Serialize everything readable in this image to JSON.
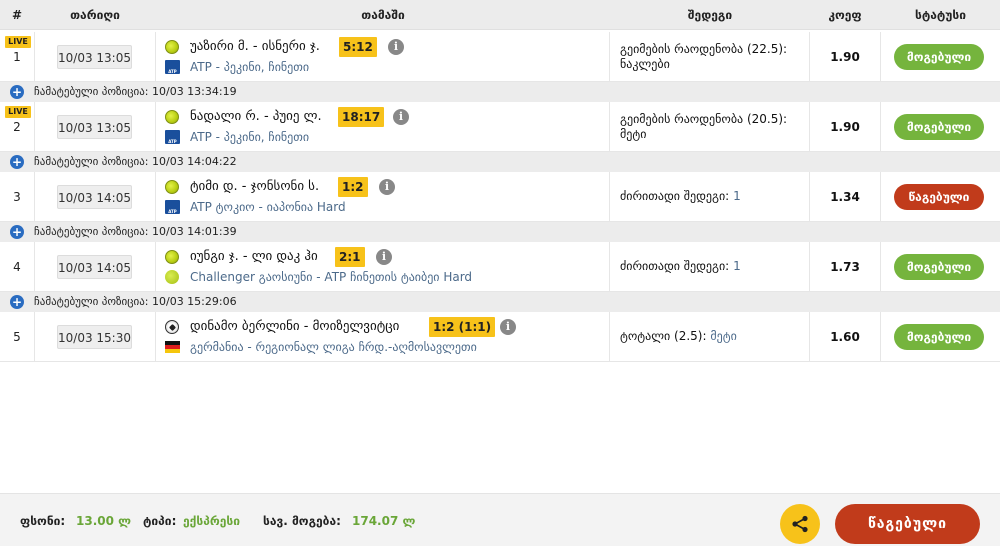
{
  "header": {
    "num": "#",
    "date": "თარიღი",
    "event": "თამაში",
    "outcome": "შედეგი",
    "odds": "კოეფ",
    "status": "სტატუსი"
  },
  "rows": [
    {
      "num": "1",
      "live": "LIVE",
      "date": "10/03 13:05",
      "teams": "უაზირი მ. - ისნერი ჯ.",
      "score": "5:12",
      "league": "ATP - პეკინი, ჩინეთი",
      "market": "გეიმების რაოდენობა (22.5):",
      "market_value": "ნაკლები",
      "odd": "1.90",
      "status": "მოგებული"
    },
    {
      "num": "2",
      "live": "LIVE",
      "date": "10/03 13:05",
      "teams": "ნადალი რ. - პუიე ლ.",
      "score": "18:17",
      "league": "ATP - პეკინი, ჩინეთი",
      "market": "გეიმების რაოდენობა (20.5):",
      "market_value": "მეტი",
      "odd": "1.90",
      "status": "მოგებული"
    },
    {
      "num": "3",
      "live": "",
      "date": "10/03 14:05",
      "teams": "ტიმი დ. - ჯონსონი ს.",
      "score": "1:2",
      "league": "ATP ტოკიო - იაპონია Hard",
      "market": "ძირითადი შედეგი:",
      "market_value": "1",
      "odd": "1.34",
      "status": "წაგებული"
    },
    {
      "num": "4",
      "live": "",
      "date": "10/03 14:05",
      "teams": "იუნგი ჯ. - ლი დაკ ჰი",
      "score": "2:1",
      "league": "Challenger გაოსიუნი - ATP ჩინეთის ტაიბეი Hard",
      "market": "ძირითადი შედეგი:",
      "market_value": "1",
      "odd": "1.73",
      "status": "მოგებული"
    },
    {
      "num": "5",
      "live": "",
      "date": "10/03 15:30",
      "teams": "დინამო ბერლინი - მოიზელვიტცი",
      "score": "1:2 (1:1)",
      "league": "გერმანია - რეგიონალ ლიგა ჩრდ.-აღმოსავლეთი",
      "market": "ტოტალი (2.5):",
      "market_value": "მეტი",
      "odd": "1.60",
      "status": "მოგებული"
    }
  ],
  "calcs": [
    "ჩამატებული პოზიცია: 10/03 13:34:19",
    "ჩამატებული პოზიცია: 10/03 14:04:22",
    "ჩამატებული პოზიცია: 10/03 14:01:39",
    "ჩამატებული პოზიცია: 10/03 15:29:06"
  ],
  "footer": {
    "stake_label": "ფსონი:",
    "stake_value": "13.00 ლ",
    "type_label": "ტიპი:",
    "type_value": "ექსპრესი",
    "win_label": "სავ. მოგება:",
    "win_value": "174.07 ლ",
    "final_status": "წაგებული"
  },
  "colors": {
    "won": "#75b43d",
    "lost": "#c13b1b",
    "accent": "#f7c21a",
    "link": "#4c6a8a",
    "plus": "#2a6cc1"
  }
}
